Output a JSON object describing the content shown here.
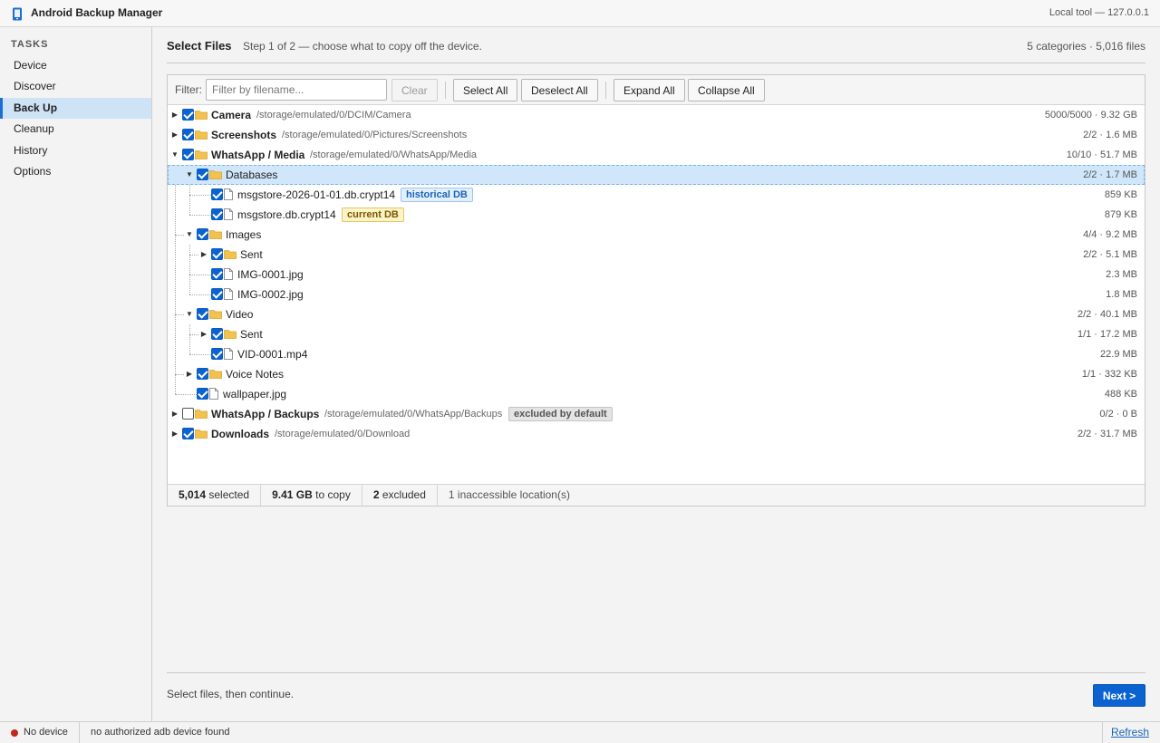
{
  "app": {
    "title": "Android Backup Manager",
    "host": "Local tool — 127.0.0.1"
  },
  "sidebar": {
    "heading": "TASKS",
    "items": [
      {
        "label": "Device",
        "active": false
      },
      {
        "label": "Discover",
        "active": false
      },
      {
        "label": "Back Up",
        "active": true
      },
      {
        "label": "Cleanup",
        "active": false
      },
      {
        "label": "History",
        "active": false
      },
      {
        "label": "Options",
        "active": false
      }
    ]
  },
  "header": {
    "title": "Select Files",
    "subtitle": "Step 1 of 2 — choose what to copy off the device.",
    "counts": "5 categories · 5,016 files"
  },
  "toolbar": {
    "filter_label": "Filter:",
    "filter_placeholder": "Filter by filename...",
    "filter_value": "",
    "clear_label": "Clear",
    "select_all_label": "Select All",
    "deselect_all_label": "Deselect All",
    "expand_all_label": "Expand All",
    "collapse_all_label": "Collapse All"
  },
  "tree": [
    {
      "name": "Camera",
      "path": "/storage/emulated/0/DCIM/Camera",
      "stat": "5000/5000 · 9.32 GB",
      "checked": true
    },
    {
      "name": "Screenshots",
      "path": "/storage/emulated/0/Pictures/Screenshots",
      "stat": "2/2 · 1.6 MB",
      "checked": true
    },
    {
      "name": "WhatsApp / Media",
      "path": "/storage/emulated/0/WhatsApp/Media",
      "stat": "10/10 · 51.7 MB",
      "checked": true
    },
    {
      "name": "Databases",
      "stat": "2/2 · 1.7 MB",
      "checked": true
    },
    {
      "name": "msgstore-2026-01-01.db.crypt14",
      "badge": "historical DB",
      "stat": "859 KB",
      "checked": true
    },
    {
      "name": "msgstore.db.crypt14",
      "badge": "current DB",
      "stat": "879 KB",
      "checked": true
    },
    {
      "name": "Images",
      "stat": "4/4 · 9.2 MB",
      "checked": true
    },
    {
      "name": "Sent",
      "stat": "2/2 · 5.1 MB",
      "checked": true
    },
    {
      "name": "IMG-0001.jpg",
      "stat": "2.3 MB",
      "checked": true
    },
    {
      "name": "IMG-0002.jpg",
      "stat": "1.8 MB",
      "checked": true
    },
    {
      "name": "Video",
      "stat": "2/2 · 40.1 MB",
      "checked": true
    },
    {
      "name": "Sent",
      "stat": "1/1 · 17.2 MB",
      "checked": true
    },
    {
      "name": "VID-0001.mp4",
      "stat": "22.9 MB",
      "checked": true
    },
    {
      "name": "Voice Notes",
      "stat": "1/1 · 332 KB",
      "checked": true
    },
    {
      "name": "wallpaper.jpg",
      "stat": "488 KB",
      "checked": true
    },
    {
      "name": "WhatsApp / Backups",
      "path": "/storage/emulated/0/WhatsApp/Backups",
      "badge": "excluded by default",
      "stat": "0/2 · 0 B",
      "checked": false
    },
    {
      "name": "Downloads",
      "path": "/storage/emulated/0/Download",
      "stat": "2/2 · 31.7 MB",
      "checked": true
    }
  ],
  "summary": {
    "selected_count": "5,014",
    "selected_label": "selected",
    "size": "9.41 GB",
    "size_label": "to copy",
    "excluded_count": "2",
    "excluded_label": "excluded",
    "inaccessible": "1 inaccessible location(s)"
  },
  "footer": {
    "hint": "Select files, then continue.",
    "next_label": "Next >"
  },
  "status": {
    "device": "No device",
    "message": "no authorized adb device found",
    "refresh_label": "Refresh",
    "dot_color": "#c0281e"
  },
  "colors": {
    "accent": "#0b63d1",
    "selection": "#cfe6fb",
    "folder": "#f2c14e"
  }
}
